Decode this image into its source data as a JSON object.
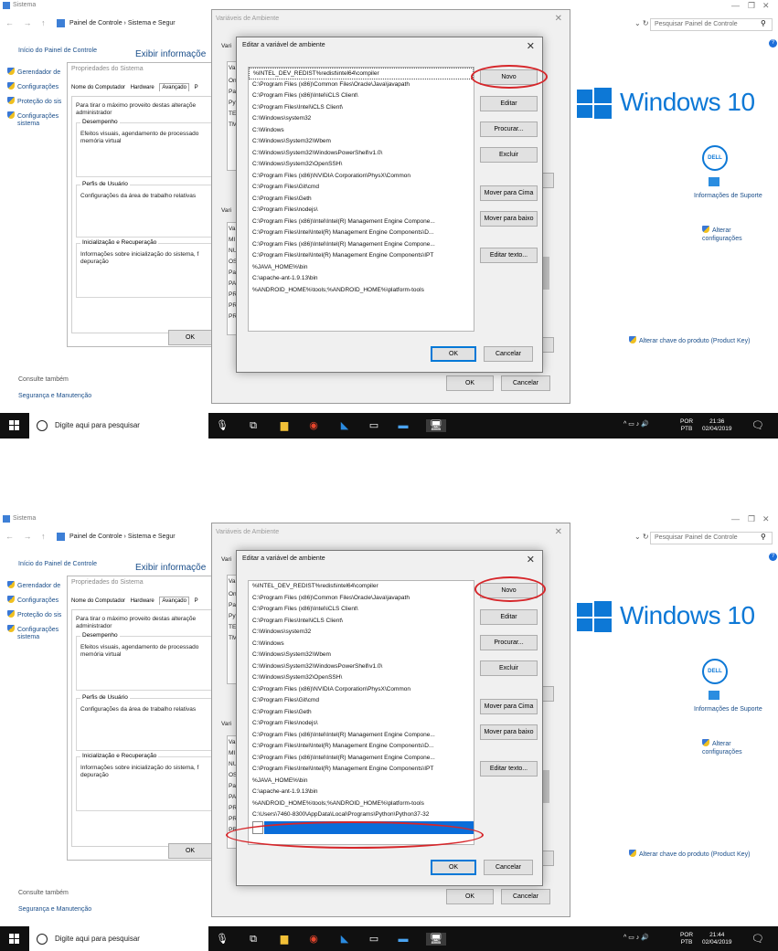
{
  "window": {
    "title": "Sistema",
    "breadcrumb": "Painel de Controle  ›  Sistema e Segur",
    "search_placeholder": "Pesquisar Painel de Controle",
    "nav_buttons": "← → ↑"
  },
  "left_panel": {
    "home_link": "Início do Painel de Controle",
    "items": [
      "Gerendador de",
      "Configurações",
      "Proteção do sis",
      "Configurações",
      "sistema"
    ],
    "see_also": "Consulte também",
    "security": "Segurança e Manutenção"
  },
  "main": {
    "view_info": "Exibir informaçõe",
    "windows_brand": "Windows 10",
    "dell_logo": "DELL",
    "support": "Informações de Suporte",
    "change_settings_1": "Alterar",
    "change_settings_2": "configurações",
    "product_key": "Alterar chave do produto (Product Key)"
  },
  "props_dialog": {
    "title": "Propriedades do Sistema",
    "tabs": [
      "Nome do Computador",
      "Hardware",
      "Avançado",
      "P"
    ],
    "admin_note_1": "Para tirar o máximo proveito destas alteraçõe",
    "admin_note_2": "administrador",
    "perf_label": "Desempenho",
    "perf_text_1": "Efeitos visuais, agendamento de processado",
    "perf_text_2": "memória virtual",
    "profiles_label": "Perfis de Usuário",
    "profiles_text": "Configurações da área de trabalho relativas",
    "startup_label": "Inicialização e Recuperação",
    "startup_text_1": "Informações sobre inicialização do sistema, f",
    "startup_text_2": "depuração",
    "ok": "OK"
  },
  "env_dialog": {
    "title": "Variáveis de Ambiente",
    "user_section": "Vari",
    "sys_section": "Vari",
    "user_col_prefixes": [
      "Va",
      "On",
      "Pat",
      "Pyt",
      "TEI",
      "TM"
    ],
    "sys_col_prefixes": [
      "Va",
      "MI",
      "NU",
      "OS",
      "Pat",
      "PA",
      "PR",
      "PR",
      "PR"
    ],
    "ok": "OK",
    "cancel": "Cancelar"
  },
  "edit_dialog": {
    "title": "Editar a variável de ambiente",
    "paths": [
      "%INTEL_DEV_REDIST%redist\\intel64\\compiler",
      "C:\\Program Files (x86)\\Common Files\\Oracle\\Java\\javapath",
      "C:\\Program Files (x86)\\Intel\\iCLS Client\\",
      "C:\\Program Files\\Intel\\iCLS Client\\",
      "C:\\Windows\\system32",
      "C:\\Windows",
      "C:\\Windows\\System32\\Wbem",
      "C:\\Windows\\System32\\WindowsPowerShell\\v1.0\\",
      "C:\\Windows\\System32\\OpenSSH\\",
      "C:\\Program Files (x86)\\NVIDIA Corporation\\PhysX\\Common",
      "C:\\Program Files\\Git\\cmd",
      "C:\\Program Files\\Geth",
      "C:\\Program Files\\nodejs\\",
      "C:\\Program Files (x86)\\Intel\\Intel(R) Management Engine Compone...",
      "C:\\Program Files\\Intel\\Intel(R) Management Engine Components\\D...",
      "C:\\Program Files (x86)\\Intel\\Intel(R) Management Engine Compone...",
      "C:\\Program Files\\Intel\\Intel(R) Management Engine Components\\IPT",
      "%JAVA_HOME%\\bin",
      "C:\\apache-ant-1.9.13\\bin",
      "%ANDROID_HOME%\\tools;%ANDROID_HOME%\\platform-tools"
    ],
    "added_path": "C:\\Users\\7460-8300\\AppData\\Local\\Programs\\Python\\Python37-32",
    "buttons": {
      "new": "Novo",
      "edit": "Editar",
      "browse": "Procurar...",
      "delete": "Excluir",
      "move_up": "Mover para Cima",
      "move_down": "Mover para baixo",
      "edit_text": "Editar texto..."
    },
    "ok": "OK",
    "cancel": "Cancelar"
  },
  "taskbar": {
    "search": "Digite aqui para pesquisar",
    "lang_1": "POR",
    "lang_2": "PTB",
    "time_first": "21:36",
    "time_second": "21:44",
    "date": "02/04/2019"
  },
  "colors": {
    "accent": "#0d78d6",
    "highlight_ellipse": "#d6262a",
    "selection": "#0a6dd9"
  }
}
